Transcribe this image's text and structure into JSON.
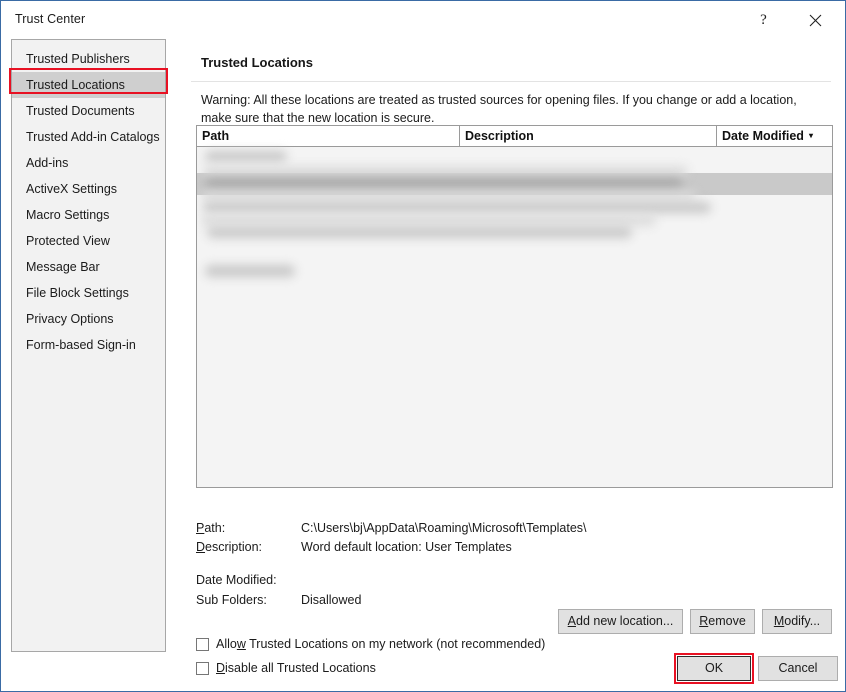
{
  "window": {
    "title": "Trust Center",
    "help_icon": "question-mark-icon",
    "close_icon": "close-icon",
    "border_color": "#3a6ba5"
  },
  "sidebar": {
    "items": [
      {
        "label": "Trusted Publishers",
        "selected": false
      },
      {
        "label": "Trusted Locations",
        "selected": true
      },
      {
        "label": "Trusted Documents",
        "selected": false
      },
      {
        "label": "Trusted Add-in Catalogs",
        "selected": false
      },
      {
        "label": "Add-ins",
        "selected": false
      },
      {
        "label": "ActiveX Settings",
        "selected": false
      },
      {
        "label": "Macro Settings",
        "selected": false
      },
      {
        "label": "Protected View",
        "selected": false
      },
      {
        "label": "Message Bar",
        "selected": false
      },
      {
        "label": "File Block Settings",
        "selected": false
      },
      {
        "label": "Privacy Options",
        "selected": false
      },
      {
        "label": "Form-based Sign-in",
        "selected": false
      }
    ],
    "selected_index": 1,
    "selected_bg": "#cfcfcf"
  },
  "annotations": {
    "color": "#e81123",
    "targets": [
      "sidebar-item-trusted-locations",
      "ok-button"
    ]
  },
  "main": {
    "title": "Trusted Locations",
    "warning": "Warning: All these locations are treated as trusted sources for opening files.  If you change or add a location, make sure that the new location is secure.",
    "table": {
      "columns": [
        "Path",
        "Description",
        "Date Modified"
      ],
      "sort_column": "Date Modified",
      "sort_caret": "▾",
      "rows_redacted": true,
      "selected_row_index": 1
    },
    "details": {
      "path_label": "Path:",
      "path_value": "C:\\Users\\bj\\AppData\\Roaming\\Microsoft\\Templates\\",
      "description_label": "Description:",
      "description_value": "Word default location: User Templates",
      "date_modified_label": "Date Modified:",
      "date_modified_value": "",
      "sub_folders_label": "Sub Folders:",
      "sub_folders_value": "Disallowed"
    },
    "buttons": {
      "add_new_location": "Add new location...",
      "remove": "Remove",
      "modify": "Modify..."
    },
    "checkboxes": [
      {
        "label": "Allow Trusted Locations on my network (not recommended)",
        "checked": false
      },
      {
        "label": "Disable all Trusted Locations",
        "checked": false
      }
    ]
  },
  "footer": {
    "ok": "OK",
    "cancel": "Cancel"
  }
}
